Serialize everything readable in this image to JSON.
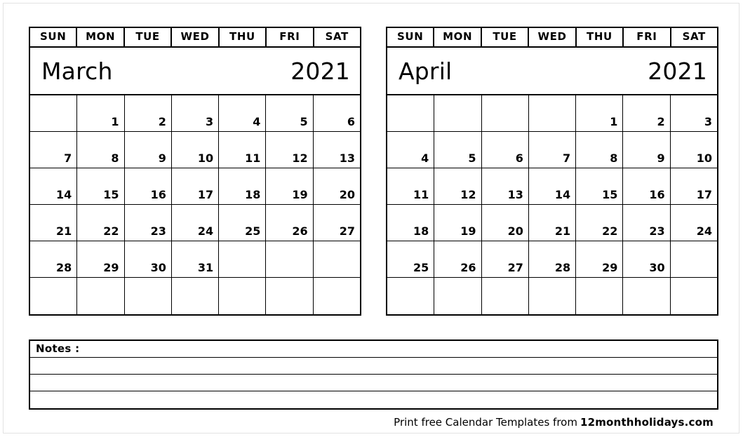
{
  "page": {
    "background_color": "#ffffff",
    "border_color": "#e2e2e2",
    "ink_color": "#000000"
  },
  "weekday_headers": [
    "SUN",
    "MON",
    "TUE",
    "WED",
    "THU",
    "FRI",
    "SAT"
  ],
  "calendars": [
    {
      "month": "March",
      "year": "2021",
      "weeks": [
        [
          "",
          "1",
          "2",
          "3",
          "4",
          "5",
          "6"
        ],
        [
          "7",
          "8",
          "9",
          "10",
          "11",
          "12",
          "13"
        ],
        [
          "14",
          "15",
          "16",
          "17",
          "18",
          "19",
          "20"
        ],
        [
          "21",
          "22",
          "23",
          "24",
          "25",
          "26",
          "27"
        ],
        [
          "28",
          "29",
          "30",
          "31",
          "",
          "",
          ""
        ],
        [
          "",
          "",
          "",
          "",
          "",
          "",
          ""
        ]
      ]
    },
    {
      "month": "April",
      "year": "2021",
      "weeks": [
        [
          "",
          "",
          "",
          "",
          "1",
          "2",
          "3"
        ],
        [
          "4",
          "5",
          "6",
          "7",
          "8",
          "9",
          "10"
        ],
        [
          "11",
          "12",
          "13",
          "14",
          "15",
          "16",
          "17"
        ],
        [
          "18",
          "19",
          "20",
          "21",
          "22",
          "23",
          "24"
        ],
        [
          "25",
          "26",
          "27",
          "28",
          "29",
          "30",
          ""
        ],
        [
          "",
          "",
          "",
          "",
          "",
          "",
          ""
        ]
      ]
    }
  ],
  "notes": {
    "label": "Notes :",
    "blank_lines": 3
  },
  "footer": {
    "credit_text": "Print free Calendar Templates from",
    "site": "12monthholidays.com"
  }
}
